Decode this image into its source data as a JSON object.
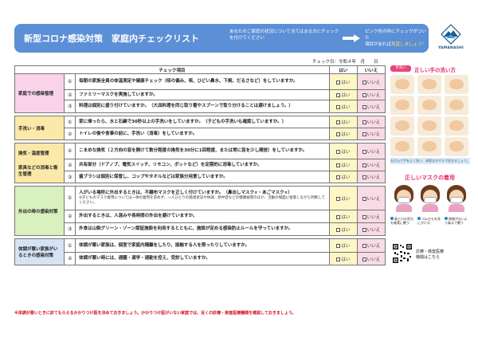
{
  "header": {
    "title": "新型コロナ感染対策　家庭内チェックリスト",
    "mid_text": "あなたのご家庭の状況について当てはまる方にチェックを付けてください",
    "right_text_1": "ピンク色の枠にチェックがついた",
    "right_text_2": "項目があれば",
    "right_text_highlight": "見直しましょう！"
  },
  "logo": {
    "text": "YAMANASHI",
    "color": "#1c5a8a"
  },
  "check_date": "チェック日：令和４年　月　　日",
  "table": {
    "header_item": "チェック項目",
    "header_yes": "はい",
    "header_no": "いいえ",
    "yes_label": "はい",
    "no_label": "いいえ",
    "groups": [
      {
        "category": "家庭での感染管理",
        "color": "#f8d3ea",
        "items": [
          {
            "num": "①",
            "text": "毎朝の家族全員の体温測定や健康チェック（咳の偏み、咳、ひどい鼻水、下痢、だるさなど）をしていますか。"
          },
          {
            "num": "②",
            "text": "ファミリーマスクを実施していますか。"
          },
          {
            "num": "③",
            "text": "料理は個別に盛り付けていますか。（大皿料理を同じ取り箸やスプーンで取り分けることは避けましょう。）"
          }
        ]
      },
      {
        "category": "手洗い・消毒",
        "color": "#fbe9a9",
        "items": [
          {
            "num": "①",
            "text": "家に帰ったら、水と石鹸で30秒以上の手洗いをしていますか。（子どもの手洗いも確認していますか。）"
          },
          {
            "num": "②",
            "text": "トイレの後や食事の前に、手洗い（消毒）をしていますか。"
          }
        ]
      },
      {
        "category": "換気・温度管理",
        "category2": "家具などの消毒と衛生管理",
        "color": "#fbe9a9",
        "items": [
          {
            "num": "①",
            "text": "こまめな換気（２方向の窓を開けて数分程度の換気を30分に1回程度、または常に窓を少し開放）をしていますか。"
          },
          {
            "num": "②",
            "text": "共有部分（ドアノブ、電気スイッチ、リモコン、ポットなど）を定期的に消毒していますか。"
          },
          {
            "num": "③",
            "text": "歯ブラシは個別に保管し、コップやタオルなどは家族分用意していますか。"
          }
        ]
      },
      {
        "category": "外出の時の感染対策",
        "color": "#d9f0bf",
        "items": [
          {
            "num": "①",
            "text": "人がいる場所に外出するときは、不織布マスクを正しく付けていますか。（鼻出しマスク×・あごマスク×）",
            "note": "※子どものマスク着用については一律の着用を求めず、一人ひとりの発達状況や体調、熱中症などの健康被害のほか、活動の場面に留意しながら判断してください。"
          },
          {
            "num": "②",
            "text": "外出するときは、人混みや長時間の外出を避けていますか。"
          },
          {
            "num": "③",
            "text": "外食は山梨グリーン・ゾーン認証施設を利用するとともに、施設が定める感染防止ルールを守っていますか。"
          }
        ]
      },
      {
        "category": "体調が悪い家族がいるときの感染対策",
        "color": "#d5e3f5",
        "items": [
          {
            "num": "①",
            "text": "体調が悪い家族は、個室で家庭内隔離をしたり、接触する人を限ったりしていますか。"
          },
          {
            "num": "②",
            "text": "体調が悪い時には、通園・通学・通勤を控え、受診していますか。"
          }
        ]
      }
    ]
  },
  "footer_note": "※体調が悪いときに診てもらえるかかりつけ医を決めておきましょう。かかりつけ医がいない家庭では、近くの診療・検査医療機関を確認しておきましょう。",
  "hand_panel": {
    "badge": "手洗い",
    "title": "正しい手の洗い方",
    "footer": "石けんで手をよく洗い、清潔なタオルで拭きましょう。"
  },
  "mask_panel": {
    "title": "正しいマスクの着用",
    "captions": [
      "鼻と口の両方を確実に覆う",
      "ゴムひもを耳にかける",
      "隙間がないよう鼻まで覆う"
    ]
  },
  "qr": {
    "text_1": "診療・検査医療",
    "text_2": "機関はこちら"
  }
}
